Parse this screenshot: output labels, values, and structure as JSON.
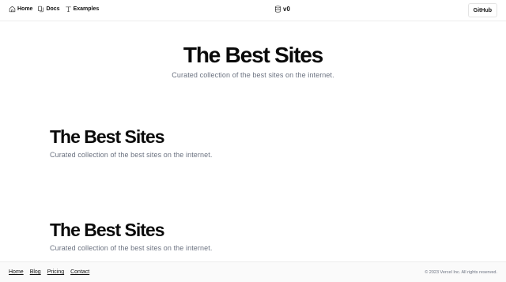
{
  "header": {
    "nav": [
      {
        "label": "Home",
        "icon": "home-icon"
      },
      {
        "label": "Docs",
        "icon": "docs-icon"
      },
      {
        "label": "Examples",
        "icon": "text-icon"
      }
    ],
    "brand": {
      "label": "v0",
      "icon": "database-icon"
    },
    "github_label": "GitHub"
  },
  "hero": {
    "title": "The Best Sites",
    "subtitle": "Curated collection of the best sites on the internet."
  },
  "sections": [
    {
      "title": "The Best Sites",
      "subtitle": "Curated collection of the best sites on the internet."
    },
    {
      "title": "The Best Sites",
      "subtitle": "Curated collection of the best sites on the internet."
    }
  ],
  "footer": {
    "links": [
      "Home",
      "Blog",
      "Pricing",
      "Contact"
    ],
    "copyright": "© 2023 Vercel Inc. All rights reserved."
  }
}
